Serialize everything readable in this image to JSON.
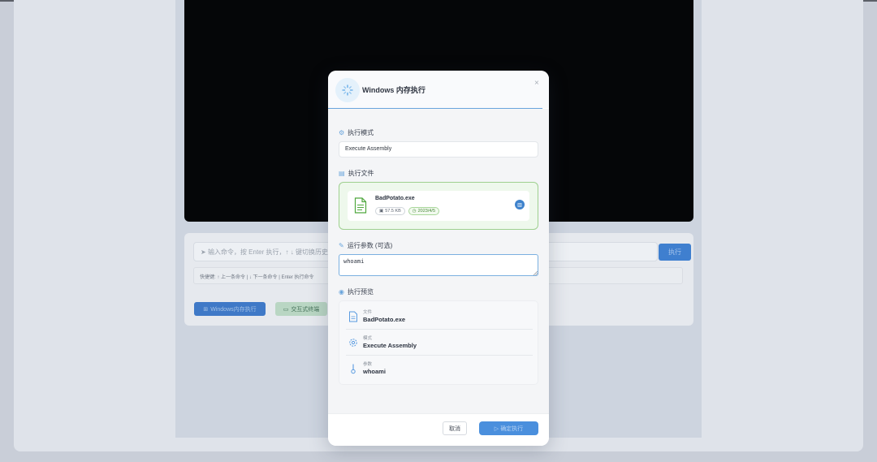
{
  "background": {
    "cmd_placeholder": "输入命令，按 Enter 执行，↑ ↓ 键切换历史命令",
    "cmd_exec_label": "执行",
    "shortcut_text": "快捷键: ↑ 上一条命令 | ↓ 下一条命令 | Enter 执行命令",
    "btn_windows_exec": "Windows内存执行",
    "btn_interactive_terminal": "交互式终端"
  },
  "modal": {
    "title": "Windows 内存执行",
    "close_glyph": "×",
    "mode": {
      "label": "执行模式",
      "selected": "Execute Assembly"
    },
    "file": {
      "label": "执行文件",
      "name": "BadPotato.exe",
      "size": "57.5 KB",
      "date": "2023/4/5"
    },
    "args": {
      "label": "运行参数 (可选)",
      "value": "whoami"
    },
    "preview": {
      "label": "执行预览",
      "rows": [
        {
          "key": "文件",
          "value": "BadPotato.exe",
          "icon": "file-icon"
        },
        {
          "key": "模式",
          "value": "Execute Assembly",
          "icon": "gear-icon"
        },
        {
          "key": "参数",
          "value": "whoami",
          "icon": "thermometer-icon"
        }
      ]
    },
    "footer": {
      "cancel_label": "取消",
      "confirm_label": "确定执行"
    }
  },
  "colors": {
    "accent": "#4a8fdd",
    "file_zone_border": "#9ed08f",
    "terminal_bg": "#050608"
  }
}
